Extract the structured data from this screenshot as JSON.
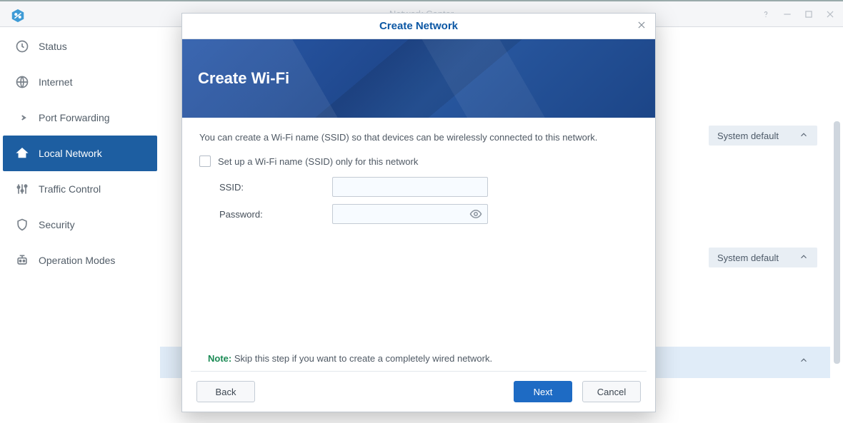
{
  "topbar": {
    "bg_window_title": "Network Center"
  },
  "sidebar": {
    "items": [
      {
        "label": "Status"
      },
      {
        "label": "Internet"
      },
      {
        "label": "Port Forwarding"
      },
      {
        "label": "Local Network"
      },
      {
        "label": "Traffic Control"
      },
      {
        "label": "Security"
      },
      {
        "label": "Operation Modes"
      }
    ],
    "active_index": 3
  },
  "bg": {
    "chip_label": "System default"
  },
  "modal": {
    "title": "Create Network",
    "banner_heading": "Create Wi-Fi",
    "intro": "You can create a Wi-Fi name (SSID) so that devices can be wirelessly connected to this network.",
    "checkbox_label": "Set up a Wi-Fi name (SSID) only for this network",
    "fields": {
      "ssid_label": "SSID:",
      "ssid_value": "",
      "password_label": "Password:",
      "password_value": ""
    },
    "note_key": "Note:",
    "note_text": " Skip this step if you want to create a completely wired network.",
    "buttons": {
      "back": "Back",
      "next": "Next",
      "cancel": "Cancel"
    }
  }
}
